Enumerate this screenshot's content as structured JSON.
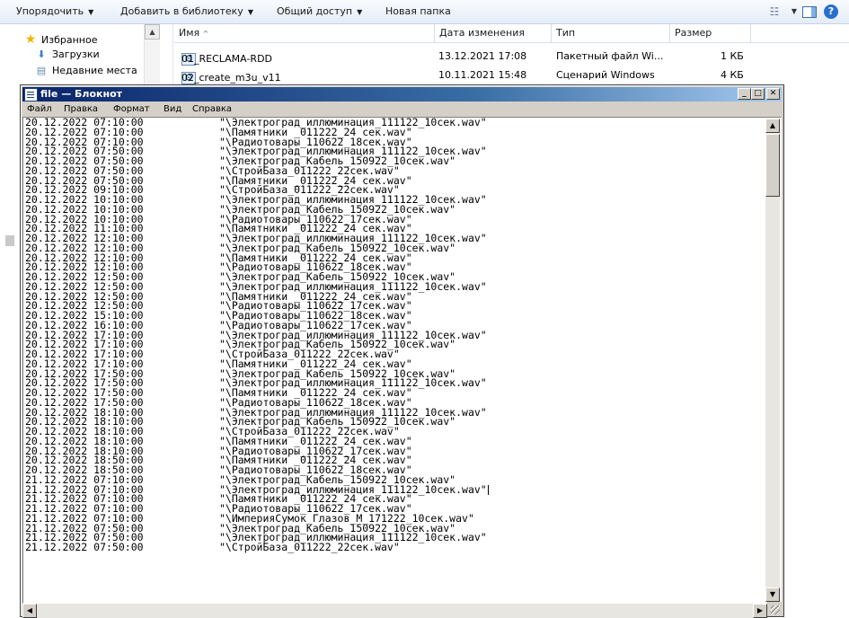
{
  "explorer": {
    "toolbar": {
      "organize": "Упорядочить",
      "add_to_library": "Добавить в библиотеку",
      "share": "Общий доступ",
      "new_folder": "Новая папка"
    },
    "nav": {
      "favorites": "Избранное",
      "downloads": "Загрузки",
      "recent": "Недавние места"
    },
    "columns": {
      "name": "Имя",
      "date": "Дата изменения",
      "type": "Тип",
      "size": "Размер"
    },
    "files": [
      {
        "name": "01_RECLAMA-RDD",
        "date": "13.12.2021 17:08",
        "type": "Пакетный файл Wi...",
        "size": "1 КБ"
      },
      {
        "name": "02_create_m3u_v11",
        "date": "10.11.2021 15:48",
        "type": "Сценарий Windows",
        "size": "4 КБ"
      }
    ]
  },
  "notepad": {
    "title": "file — Блокнот",
    "menu": {
      "file": "Файл",
      "edit": "Правка",
      "format": "Формат",
      "view": "Вид",
      "help": "Справка"
    },
    "lines": [
      {
        "dt": "20.12.2022 07:10:00",
        "file": "\"\\Электроград_иллюминация_111122_10сек.wav\""
      },
      {
        "dt": "20.12.2022 07:10:00",
        "file": "\"\\Памятники _011222_24 сек.wav\""
      },
      {
        "dt": "20.12.2022 07:10:00",
        "file": "\"\\Радиотовары_110622_18сек.wav\""
      },
      {
        "dt": "20.12.2022 07:50:00",
        "file": "\"\\Электроград_иллюминация_111122_10сек.wav\""
      },
      {
        "dt": "20.12.2022 07:50:00",
        "file": "\"\\Электроград_Кабель_150922_10сек.wav\""
      },
      {
        "dt": "20.12.2022 07:50:00",
        "file": "\"\\СтройБаза_011222_22сек.wav\""
      },
      {
        "dt": "20.12.2022 07:50:00",
        "file": "\"\\Памятники _011222_24 сек.wav\""
      },
      {
        "dt": "20.12.2022 09:10:00",
        "file": "\"\\СтройБаза_011222_22сек.wav\""
      },
      {
        "dt": "20.12.2022 10:10:00",
        "file": "\"\\Электроград_иллюминация_111122_10сек.wav\""
      },
      {
        "dt": "20.12.2022 10:10:00",
        "file": "\"\\Электроград_Кабель_150922_10сек.wav\""
      },
      {
        "dt": "20.12.2022 10:10:00",
        "file": "\"\\Радиотовары_110622_17сек.wav\""
      },
      {
        "dt": "20.12.2022 11:10:00",
        "file": "\"\\Памятники _011222_24 сек.wav\""
      },
      {
        "dt": "20.12.2022 12:10:00",
        "file": "\"\\Электроград_иллюминация_111122_10сек.wav\""
      },
      {
        "dt": "20.12.2022 12:10:00",
        "file": "\"\\Электроград_Кабель_150922_10сек.wav\""
      },
      {
        "dt": "20.12.2022 12:10:00",
        "file": "\"\\Памятники _011222_24 сек.wav\""
      },
      {
        "dt": "20.12.2022 12:10:00",
        "file": "\"\\Радиотовары_110622_18сек.wav\""
      },
      {
        "dt": "20.12.2022 12:50:00",
        "file": "\"\\Электроград_Кабель_150922_10сек.wav\""
      },
      {
        "dt": "20.12.2022 12:50:00",
        "file": "\"\\Электроград_иллюминация_111122_10сек.wav\""
      },
      {
        "dt": "20.12.2022 12:50:00",
        "file": "\"\\Памятники _011222_24 сек.wav\""
      },
      {
        "dt": "20.12.2022 12:50:00",
        "file": "\"\\Радиотовары_110622_17сек.wav\""
      },
      {
        "dt": "20.12.2022 15:10:00",
        "file": "\"\\Радиотовары_110622_18сек.wav\""
      },
      {
        "dt": "20.12.2022 16:10:00",
        "file": "\"\\Радиотовары_110622_17сек.wav\""
      },
      {
        "dt": "20.12.2022 17:10:00",
        "file": "\"\\Электроград_иллюминация_111122_10сек.wav\""
      },
      {
        "dt": "20.12.2022 17:10:00",
        "file": "\"\\Электроград_Кабель_150922_10сек.wav\""
      },
      {
        "dt": "20.12.2022 17:10:00",
        "file": "\"\\СтройБаза_011222_22сек.wav\""
      },
      {
        "dt": "20.12.2022 17:10:00",
        "file": "\"\\Памятники _011222_24 сек.wav\""
      },
      {
        "dt": "20.12.2022 17:50:00",
        "file": "\"\\Электроград_Кабель_150922_10сек.wav\""
      },
      {
        "dt": "20.12.2022 17:50:00",
        "file": "\"\\Электроград_иллюминация_111122_10сек.wav\""
      },
      {
        "dt": "20.12.2022 17:50:00",
        "file": "\"\\Памятники _011222_24 сек.wav\""
      },
      {
        "dt": "20.12.2022 17:50:00",
        "file": "\"\\Радиотовары_110622_18сек.wav\""
      },
      {
        "dt": "20.12.2022 18:10:00",
        "file": "\"\\Электроград_иллюминация_111122_10сек.wav\""
      },
      {
        "dt": "20.12.2022 18:10:00",
        "file": "\"\\Электроград_Кабель_150922_10сек.wav\""
      },
      {
        "dt": "20.12.2022 18:10:00",
        "file": "\"\\СтройБаза_011222_22сек.wav\""
      },
      {
        "dt": "20.12.2022 18:10:00",
        "file": "\"\\Памятники _011222_24 сек.wav\""
      },
      {
        "dt": "20.12.2022 18:10:00",
        "file": "\"\\Радиотовары_110622_17сек.wav\""
      },
      {
        "dt": "20.12.2022 18:50:00",
        "file": "\"\\Памятники _011222_24 сек.wav\""
      },
      {
        "dt": "20.12.2022 18:50:00",
        "file": "\"\\Радиотовары_110622_18сек.wav\""
      },
      {
        "dt": "21.12.2022 07:10:00",
        "file": "\"\\Электроград_Кабель_150922_10сек.wav\""
      },
      {
        "dt": "21.12.2022 07:10:00",
        "file": "\"\\Электроград_иллюминация_111122_10сек.wav\""
      },
      {
        "dt": "21.12.2022 07:10:00",
        "file": "\"\\Памятники _011222_24 сек.wav\""
      },
      {
        "dt": "21.12.2022 07:10:00",
        "file": "\"\\Радиотовары_110622_17сек.wav\""
      },
      {
        "dt": "21.12.2022 07:10:00",
        "file": "\"\\ИмперияСумок_Глазов_М_171222_10сек.wav\""
      },
      {
        "dt": "21.12.2022 07:50:00",
        "file": "\"\\Электроград_Кабель_150922_10сек.wav\""
      },
      {
        "dt": "21.12.2022 07:50:00",
        "file": "\"\\Электроград_иллюминация_111122_10сек.wav\""
      },
      {
        "dt": "21.12.2022 07:50:00",
        "file": "\"\\СтройБаза_011222_22сек.wav\""
      }
    ]
  }
}
